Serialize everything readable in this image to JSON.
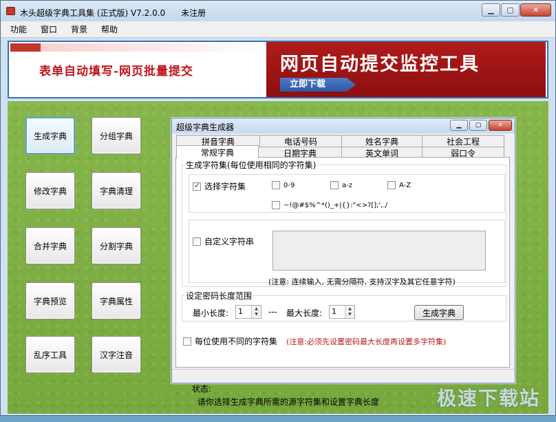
{
  "window": {
    "title": "木头超级字典工具集 (正式版) V7.2.0.0      未注册"
  },
  "menu": [
    "功能",
    "窗口",
    "背景",
    "帮助"
  ],
  "banner": {
    "left_text": "表单自动填写-网页批量提交",
    "right_text": "网页自动提交监控工具",
    "download_label": "立即下载"
  },
  "function_buttons": [
    "生成字典",
    "分组字典",
    "修改字典",
    "字典清理",
    "合并字典",
    "分割字典",
    "字典预览",
    "字典属性",
    "乱序工具",
    "汉字注音"
  ],
  "dialog": {
    "title": "超级字典生成器",
    "tabs_back": [
      "拼音字典",
      "电话号码",
      "姓名字典",
      "社会工程"
    ],
    "tabs_front": [
      "常规字典",
      "日期字典",
      "英文单词",
      "弱口令"
    ],
    "charset_group_label": "生成字符集(每位使用相同的字符集)",
    "select_charset_label": "选择字符集",
    "charset_digits": "0-9",
    "charset_lower": "a-z",
    "charset_upper": "A-Z",
    "charset_symbols": "~!@#$%^*()_+|{}:\"<>?[];',./",
    "custom_label": "自定义字符串",
    "custom_note": "(注意: 连续输入, 无需分隔符, 支持汉字及其它任意字符)",
    "length_group_label": "设定密码长度范围",
    "min_label": "最小长度:",
    "min_value": "1",
    "separator": "---",
    "max_label": "最大长度:",
    "max_value": "1",
    "generate_button": "生成字典",
    "per_position_label": "每位使用不同的字符集",
    "per_position_note": "(注意:必须先设置密码最大长度再设置多字符集)",
    "status_label": "状态:",
    "status_text": "请你选择生成字典所需的源字符集和设置字典长度"
  },
  "watermark": "极速下载站",
  "colors": {
    "banner_red": "#b01b1b",
    "note_red": "#c0141b",
    "grass_green": "#7fb044"
  }
}
